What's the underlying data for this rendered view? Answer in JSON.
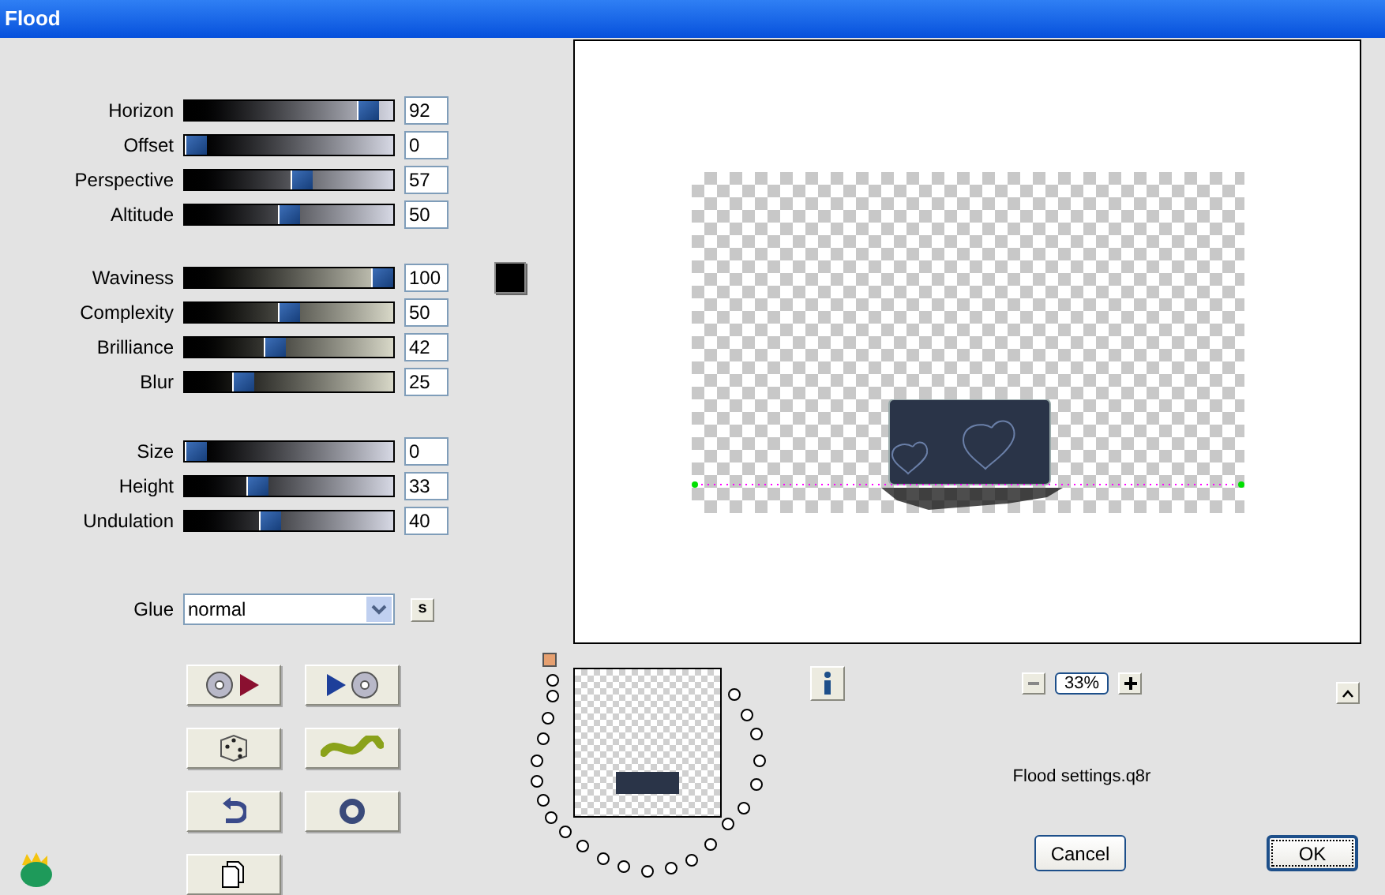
{
  "window": {
    "title": "Flood"
  },
  "slider_groups": [
    {
      "sliders": [
        {
          "label": "Horizon",
          "value": "92",
          "level": 0.92
        },
        {
          "label": "Offset",
          "value": "0",
          "level": 0
        },
        {
          "label": "Perspective",
          "value": "57",
          "level": 0.57
        },
        {
          "label": "Altitude",
          "value": "50",
          "level": 0.5
        }
      ]
    },
    {
      "sliders": [
        {
          "label": "Waviness",
          "value": "100",
          "level": 1
        },
        {
          "label": "Complexity",
          "value": "50",
          "level": 0.5
        },
        {
          "label": "Brilliance",
          "value": "42",
          "level": 0.42
        },
        {
          "label": "Blur",
          "value": "25",
          "level": 0.25
        }
      ]
    },
    {
      "sliders": [
        {
          "label": "Size",
          "value": "0",
          "level": 0
        },
        {
          "label": "Height",
          "value": "33",
          "level": 0.33
        },
        {
          "label": "Undulation",
          "value": "40",
          "level": 0.4
        }
      ]
    }
  ],
  "glue": {
    "label": "Glue",
    "value": "normal",
    "side_button": "s"
  },
  "zoom": {
    "value": "33%"
  },
  "preset_file": "Flood settings.q8r",
  "buttons": [
    {
      "label": "Cancel",
      "default": false
    },
    {
      "label": "OK",
      "default": true
    }
  ]
}
